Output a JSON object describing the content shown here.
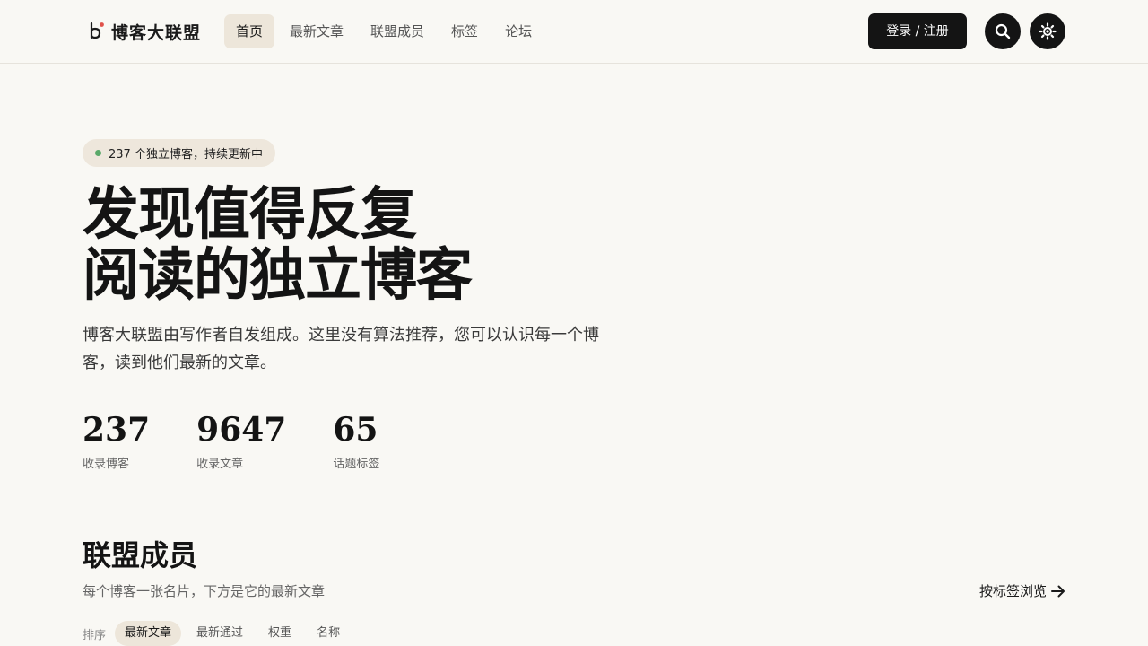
{
  "header": {
    "logo_text": "博客大联盟",
    "nav": [
      {
        "label": "首页",
        "active": true
      },
      {
        "label": "最新文章"
      },
      {
        "label": "联盟成员"
      },
      {
        "label": "标签"
      },
      {
        "label": "论坛"
      }
    ],
    "login_label": "登录 / 注册",
    "icons": {
      "search": "search-icon",
      "theme": "sun-icon"
    }
  },
  "hero": {
    "badge": "237 个独立博客，持续更新中",
    "title_line1": "发现值得反复",
    "title_line2": "阅读的独立博客",
    "description": "博客大联盟由写作者自发组成。这里没有算法推荐，您可以认识每一个博客，读到他们最新的文章。",
    "stats": [
      {
        "value": "237",
        "label": "收录博客"
      },
      {
        "value": "9647",
        "label": "收录文章"
      },
      {
        "value": "65",
        "label": "话题标签"
      }
    ]
  },
  "members": {
    "title": "联盟成员",
    "subtitle": "每个博客一张名片，下方是它的最新文章",
    "tag_link": "按标签浏览",
    "sort_label": "排序",
    "sort_options": [
      {
        "label": "最新文章",
        "active": true
      },
      {
        "label": "最新通过"
      },
      {
        "label": "权重"
      },
      {
        "label": "名称"
      }
    ]
  },
  "colors": {
    "background": "#f9f8f4",
    "accent_dark": "#141414",
    "pill": "#ede6da",
    "status_green": "#5aa96a",
    "logo_dot": "#e0524a"
  }
}
